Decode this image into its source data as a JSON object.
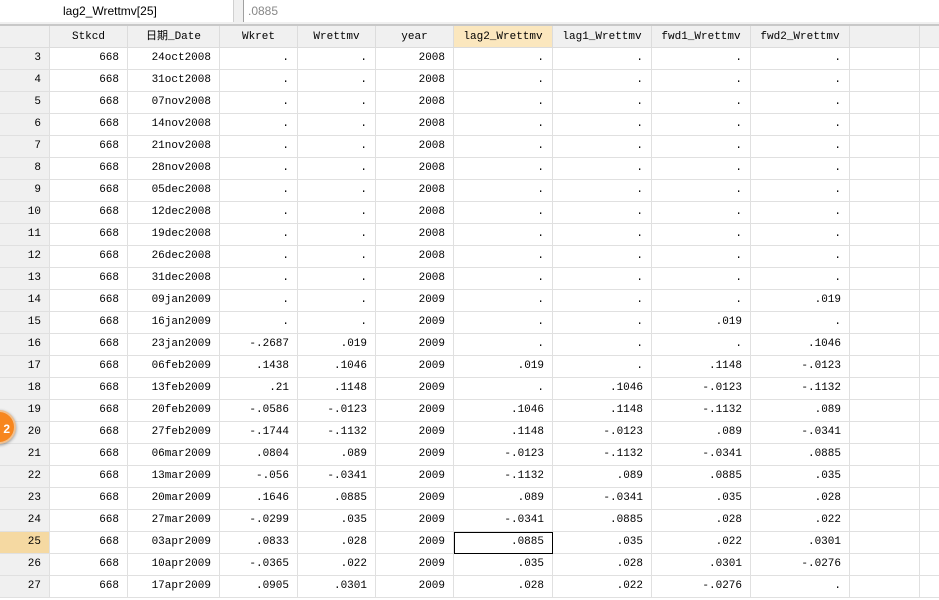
{
  "toolbar": {
    "varname": "lag2_Wrettmv[25]",
    "value": ".0885"
  },
  "columns": [
    "",
    "Stkcd",
    "日期_Date",
    "Wkret",
    "Wrettmv",
    "year",
    "lag2_Wrettmv",
    "lag1_Wrettmv",
    "fwd1_Wrettmv",
    "fwd2_Wrettmv",
    "",
    ""
  ],
  "selected_row": "25",
  "selected_col": 6,
  "badge": "2",
  "rows": [
    [
      "3",
      "668",
      "24oct2008",
      ".",
      ".",
      "2008",
      ".",
      ".",
      ".",
      "."
    ],
    [
      "4",
      "668",
      "31oct2008",
      ".",
      ".",
      "2008",
      ".",
      ".",
      ".",
      "."
    ],
    [
      "5",
      "668",
      "07nov2008",
      ".",
      ".",
      "2008",
      ".",
      ".",
      ".",
      "."
    ],
    [
      "6",
      "668",
      "14nov2008",
      ".",
      ".",
      "2008",
      ".",
      ".",
      ".",
      "."
    ],
    [
      "7",
      "668",
      "21nov2008",
      ".",
      ".",
      "2008",
      ".",
      ".",
      ".",
      "."
    ],
    [
      "8",
      "668",
      "28nov2008",
      ".",
      ".",
      "2008",
      ".",
      ".",
      ".",
      "."
    ],
    [
      "9",
      "668",
      "05dec2008",
      ".",
      ".",
      "2008",
      ".",
      ".",
      ".",
      "."
    ],
    [
      "10",
      "668",
      "12dec2008",
      ".",
      ".",
      "2008",
      ".",
      ".",
      ".",
      "."
    ],
    [
      "11",
      "668",
      "19dec2008",
      ".",
      ".",
      "2008",
      ".",
      ".",
      ".",
      "."
    ],
    [
      "12",
      "668",
      "26dec2008",
      ".",
      ".",
      "2008",
      ".",
      ".",
      ".",
      "."
    ],
    [
      "13",
      "668",
      "31dec2008",
      ".",
      ".",
      "2008",
      ".",
      ".",
      ".",
      "."
    ],
    [
      "14",
      "668",
      "09jan2009",
      ".",
      ".",
      "2009",
      ".",
      ".",
      ".",
      ".019"
    ],
    [
      "15",
      "668",
      "16jan2009",
      ".",
      ".",
      "2009",
      ".",
      ".",
      ".019",
      "."
    ],
    [
      "16",
      "668",
      "23jan2009",
      "-.2687",
      ".019",
      "2009",
      ".",
      ".",
      ".",
      ".1046"
    ],
    [
      "17",
      "668",
      "06feb2009",
      ".1438",
      ".1046",
      "2009",
      ".019",
      ".",
      ".1148",
      "-.0123"
    ],
    [
      "18",
      "668",
      "13feb2009",
      ".21",
      ".1148",
      "2009",
      ".",
      ".1046",
      "-.0123",
      "-.1132"
    ],
    [
      "19",
      "668",
      "20feb2009",
      "-.0586",
      "-.0123",
      "2009",
      ".1046",
      ".1148",
      "-.1132",
      ".089"
    ],
    [
      "20",
      "668",
      "27feb2009",
      "-.1744",
      "-.1132",
      "2009",
      ".1148",
      "-.0123",
      ".089",
      "-.0341"
    ],
    [
      "21",
      "668",
      "06mar2009",
      ".0804",
      ".089",
      "2009",
      "-.0123",
      "-.1132",
      "-.0341",
      ".0885"
    ],
    [
      "22",
      "668",
      "13mar2009",
      "-.056",
      "-.0341",
      "2009",
      "-.1132",
      ".089",
      ".0885",
      ".035"
    ],
    [
      "23",
      "668",
      "20mar2009",
      ".1646",
      ".0885",
      "2009",
      ".089",
      "-.0341",
      ".035",
      ".028"
    ],
    [
      "24",
      "668",
      "27mar2009",
      "-.0299",
      ".035",
      "2009",
      "-.0341",
      ".0885",
      ".028",
      ".022"
    ],
    [
      "25",
      "668",
      "03apr2009",
      ".0833",
      ".028",
      "2009",
      ".0885",
      ".035",
      ".022",
      ".0301"
    ],
    [
      "26",
      "668",
      "10apr2009",
      "-.0365",
      ".022",
      "2009",
      ".035",
      ".028",
      ".0301",
      "-.0276"
    ],
    [
      "27",
      "668",
      "17apr2009",
      ".0905",
      ".0301",
      "2009",
      ".028",
      ".022",
      "-.0276",
      "."
    ]
  ]
}
